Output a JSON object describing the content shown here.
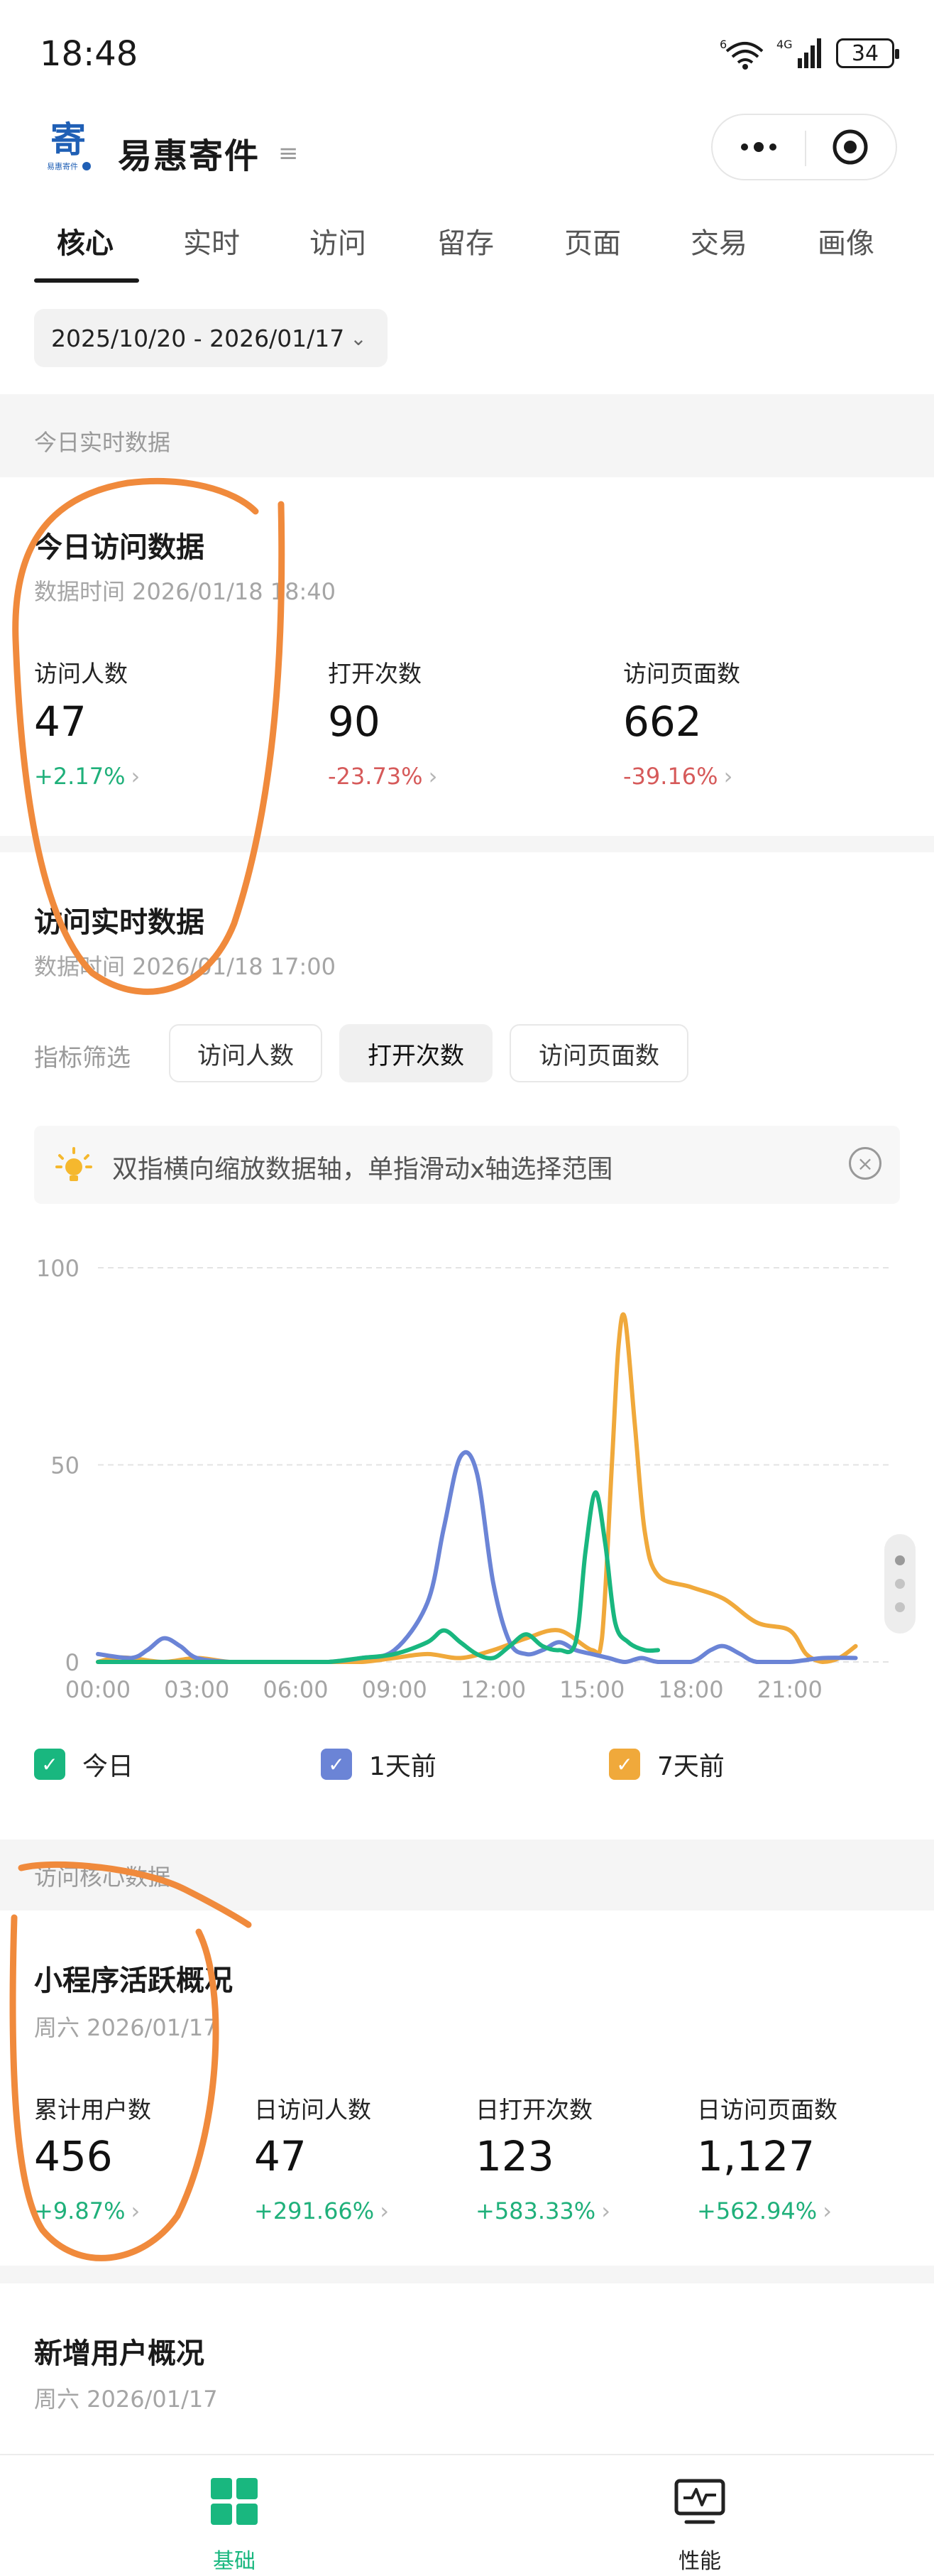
{
  "status_bar": {
    "time": "18:48",
    "battery": "34",
    "network_labels": [
      "6",
      "4G"
    ]
  },
  "header": {
    "app_title": "易惠寄件",
    "logo_text": "寄",
    "logo_subtext": "易惠寄件"
  },
  "tabs": [
    "核心",
    "实时",
    "访问",
    "留存",
    "页面",
    "交易",
    "画像"
  ],
  "active_tab": "核心",
  "date_range": "2025/10/20 - 2026/01/17",
  "realtime_section": {
    "header": "今日实时数据",
    "today_card": {
      "title": "今日访问数据",
      "time": "数据时间 2026/01/18 18:40",
      "metrics": [
        {
          "label": "访问人数",
          "value": "47",
          "delta": "+2.17%",
          "trend": "up"
        },
        {
          "label": "打开次数",
          "value": "90",
          "delta": "-23.73%",
          "trend": "down"
        },
        {
          "label": "访问页面数",
          "value": "662",
          "delta": "-39.16%",
          "trend": "down"
        }
      ]
    },
    "live_card": {
      "title": "访问实时数据",
      "time": "数据时间 2026/01/18 17:00",
      "filter_label": "指标筛选",
      "filters": [
        "访问人数",
        "打开次数",
        "访问页面数"
      ],
      "active_filter": "打开次数",
      "tip": "双指横向缩放数据轴，单指滑动x轴选择范围"
    }
  },
  "chart_data": {
    "type": "line",
    "x_ticks": [
      "00:00",
      "03:00",
      "06:00",
      "09:00",
      "12:00",
      "15:00",
      "18:00",
      "21:00"
    ],
    "y_ticks": [
      "0",
      "50",
      "100"
    ],
    "ylim": [
      0,
      100
    ],
    "xlim": [
      0,
      24
    ],
    "grid": true,
    "legend_position": "bottom",
    "series": [
      {
        "name": "今日",
        "color": "#19b77f",
        "points": [
          [
            0,
            0
          ],
          [
            1,
            0
          ],
          [
            2,
            0
          ],
          [
            3,
            0
          ],
          [
            4,
            0
          ],
          [
            5,
            0
          ],
          [
            6,
            0
          ],
          [
            7,
            0
          ],
          [
            8,
            1
          ],
          [
            9,
            2
          ],
          [
            10,
            5
          ],
          [
            10.5,
            8
          ],
          [
            11,
            5
          ],
          [
            11.5,
            2
          ],
          [
            12,
            1
          ],
          [
            12.5,
            4
          ],
          [
            13,
            7
          ],
          [
            13.5,
            4
          ],
          [
            14,
            3
          ],
          [
            14.5,
            5
          ],
          [
            14.8,
            28
          ],
          [
            15.1,
            43
          ],
          [
            15.4,
            30
          ],
          [
            15.7,
            10
          ],
          [
            16.1,
            5
          ],
          [
            16.6,
            3
          ],
          [
            17,
            3
          ]
        ]
      },
      {
        "name": "1天前",
        "color": "#6b84d6",
        "points": [
          [
            0,
            2
          ],
          [
            1,
            1
          ],
          [
            1.5,
            3
          ],
          [
            2,
            6
          ],
          [
            2.5,
            4
          ],
          [
            3,
            1
          ],
          [
            4,
            0
          ],
          [
            5,
            0
          ],
          [
            6,
            0
          ],
          [
            7,
            0
          ],
          [
            8,
            1
          ],
          [
            9,
            3
          ],
          [
            10,
            15
          ],
          [
            10.5,
            34
          ],
          [
            11,
            52
          ],
          [
            11.5,
            48
          ],
          [
            12,
            20
          ],
          [
            12.5,
            5
          ],
          [
            13,
            2
          ],
          [
            13.5,
            3
          ],
          [
            14,
            5
          ],
          [
            14.5,
            3
          ],
          [
            15,
            2
          ],
          [
            15.5,
            1
          ],
          [
            16,
            0
          ],
          [
            16.5,
            1
          ],
          [
            17,
            0
          ],
          [
            18,
            0
          ],
          [
            18.6,
            3
          ],
          [
            19,
            4
          ],
          [
            19.5,
            2
          ],
          [
            20,
            0
          ],
          [
            21,
            0
          ],
          [
            22,
            1
          ],
          [
            23,
            1
          ]
        ]
      },
      {
        "name": "7天前",
        "color": "#f0a93b",
        "points": [
          [
            0,
            0
          ],
          [
            0.5,
            1
          ],
          [
            1,
            1
          ],
          [
            2,
            0
          ],
          [
            3,
            1
          ],
          [
            4,
            0
          ],
          [
            5,
            0
          ],
          [
            6,
            0
          ],
          [
            7,
            0
          ],
          [
            8,
            0
          ],
          [
            9,
            1
          ],
          [
            10,
            2
          ],
          [
            11,
            1
          ],
          [
            12,
            3
          ],
          [
            13,
            6
          ],
          [
            14,
            8
          ],
          [
            15,
            3
          ],
          [
            15.3,
            6
          ],
          [
            15.6,
            50
          ],
          [
            15.8,
            80
          ],
          [
            16,
            87
          ],
          [
            16.3,
            60
          ],
          [
            16.6,
            33
          ],
          [
            17,
            22
          ],
          [
            18,
            19
          ],
          [
            19,
            16
          ],
          [
            20,
            10
          ],
          [
            21,
            8
          ],
          [
            21.5,
            2
          ],
          [
            22,
            0
          ],
          [
            22.5,
            1
          ],
          [
            23,
            4
          ]
        ]
      }
    ]
  },
  "legend": [
    {
      "name": "今日",
      "color": "#19b77f"
    },
    {
      "name": "1天前",
      "color": "#6b84d6"
    },
    {
      "name": "7天前",
      "color": "#f0a93b"
    }
  ],
  "core_section": {
    "header": "访问核心数据",
    "active_card": {
      "title": "小程序活跃概况",
      "time": "周六 2026/01/17",
      "metrics": [
        {
          "label": "累计用户数",
          "value": "456",
          "delta": "+9.87%",
          "trend": "up"
        },
        {
          "label": "日访问人数",
          "value": "47",
          "delta": "+291.66%",
          "trend": "up"
        },
        {
          "label": "日打开次数",
          "value": "123",
          "delta": "+583.33%",
          "trend": "up"
        },
        {
          "label": "日访问页面数",
          "value": "1,127",
          "delta": "+562.94%",
          "trend": "up"
        }
      ]
    },
    "new_user_card": {
      "title": "新增用户概况",
      "time": "周六 2026/01/17"
    }
  },
  "bottom_nav": [
    {
      "label": "基础",
      "active": true,
      "color": "#19b77f"
    },
    {
      "label": "性能",
      "active": false,
      "color": "#222222"
    }
  ]
}
